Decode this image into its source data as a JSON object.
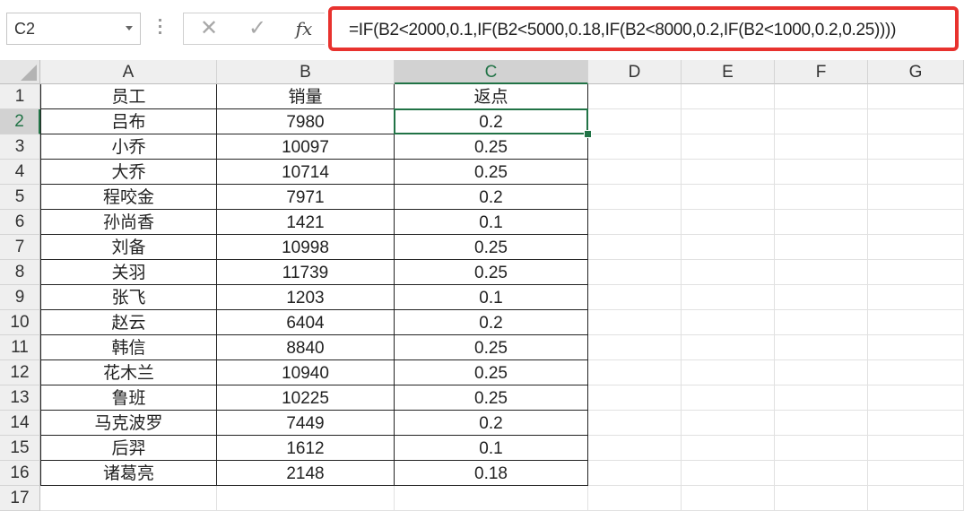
{
  "name_box": {
    "value": "C2"
  },
  "formula_bar": {
    "cancel_icon": "✕",
    "confirm_icon": "✓",
    "fx_label": "fx",
    "formula": "=IF(B2<2000,0.1,IF(B2<5000,0.18,IF(B2<8000,0.2,IF(B2<1000,0.2,0.25))))",
    "highlight_color": "#e8322e"
  },
  "columns": [
    "A",
    "B",
    "C",
    "D",
    "E",
    "F",
    "G"
  ],
  "selected_column": "C",
  "selected_row": "2",
  "row_numbers": [
    "1",
    "2",
    "3",
    "4",
    "5",
    "6",
    "7",
    "8",
    "9",
    "10",
    "11",
    "12",
    "13",
    "14",
    "15",
    "16",
    "17"
  ],
  "headers": [
    "员工",
    "销量",
    "返点"
  ],
  "rows": [
    [
      "吕布",
      "7980",
      "0.2"
    ],
    [
      "小乔",
      "10097",
      "0.25"
    ],
    [
      "大乔",
      "10714",
      "0.25"
    ],
    [
      "程咬金",
      "7971",
      "0.2"
    ],
    [
      "孙尚香",
      "1421",
      "0.1"
    ],
    [
      "刘备",
      "10998",
      "0.25"
    ],
    [
      "关羽",
      "11739",
      "0.25"
    ],
    [
      "张飞",
      "1203",
      "0.1"
    ],
    [
      "赵云",
      "6404",
      "0.2"
    ],
    [
      "韩信",
      "8840",
      "0.25"
    ],
    [
      "花木兰",
      "10940",
      "0.25"
    ],
    [
      "鲁班",
      "10225",
      "0.25"
    ],
    [
      "马克波罗",
      "7449",
      "0.2"
    ],
    [
      "后羿",
      "1612",
      "0.1"
    ],
    [
      "诸葛亮",
      "2148",
      "0.18"
    ]
  ],
  "accent_color": "#217346"
}
